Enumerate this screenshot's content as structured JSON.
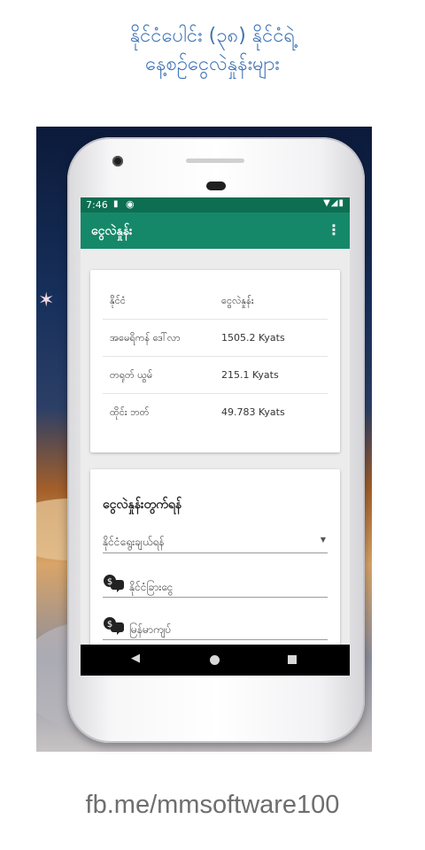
{
  "headline": {
    "line1": "နိုင်ငံပေါင်း (၃၈) နိုင်ငံရဲ့",
    "line2": "နေ့စဉ်ငွေလဲနှုန်းများ"
  },
  "statusbar": {
    "time": "7:46"
  },
  "appbar": {
    "title": "ငွေလဲနှုန်း",
    "menu_icon": "more-vert-icon"
  },
  "rates": {
    "header": {
      "country": "နိုင်ငံ",
      "rate": "ငွေလဲနှုန်း"
    },
    "rows": [
      {
        "country": "အမေရိကန် ဒေါ်လာ",
        "rate": "1505.2 Kyats"
      },
      {
        "country": "တရုတ် ယွမ်",
        "rate": "215.1 Kyats"
      },
      {
        "country": "ထိုင်း ဘတ်",
        "rate": "49.783 Kyats"
      }
    ]
  },
  "calculator": {
    "title": "ငွေလဲနှုန်းတွက်ရန်",
    "select_label": "နိုင်ငံရွေးချယ်ရန်",
    "foreign_placeholder": "နိုင်ငံခြားငွေ",
    "kyat_placeholder": "မြန်မာကျပ်",
    "field_icon": "money-chat-icon"
  },
  "colors": {
    "headline": "#3f74b6",
    "appbar": "#16886a",
    "statusbar": "#0d6e52"
  },
  "footer": "fb.me/mmsoftware100"
}
